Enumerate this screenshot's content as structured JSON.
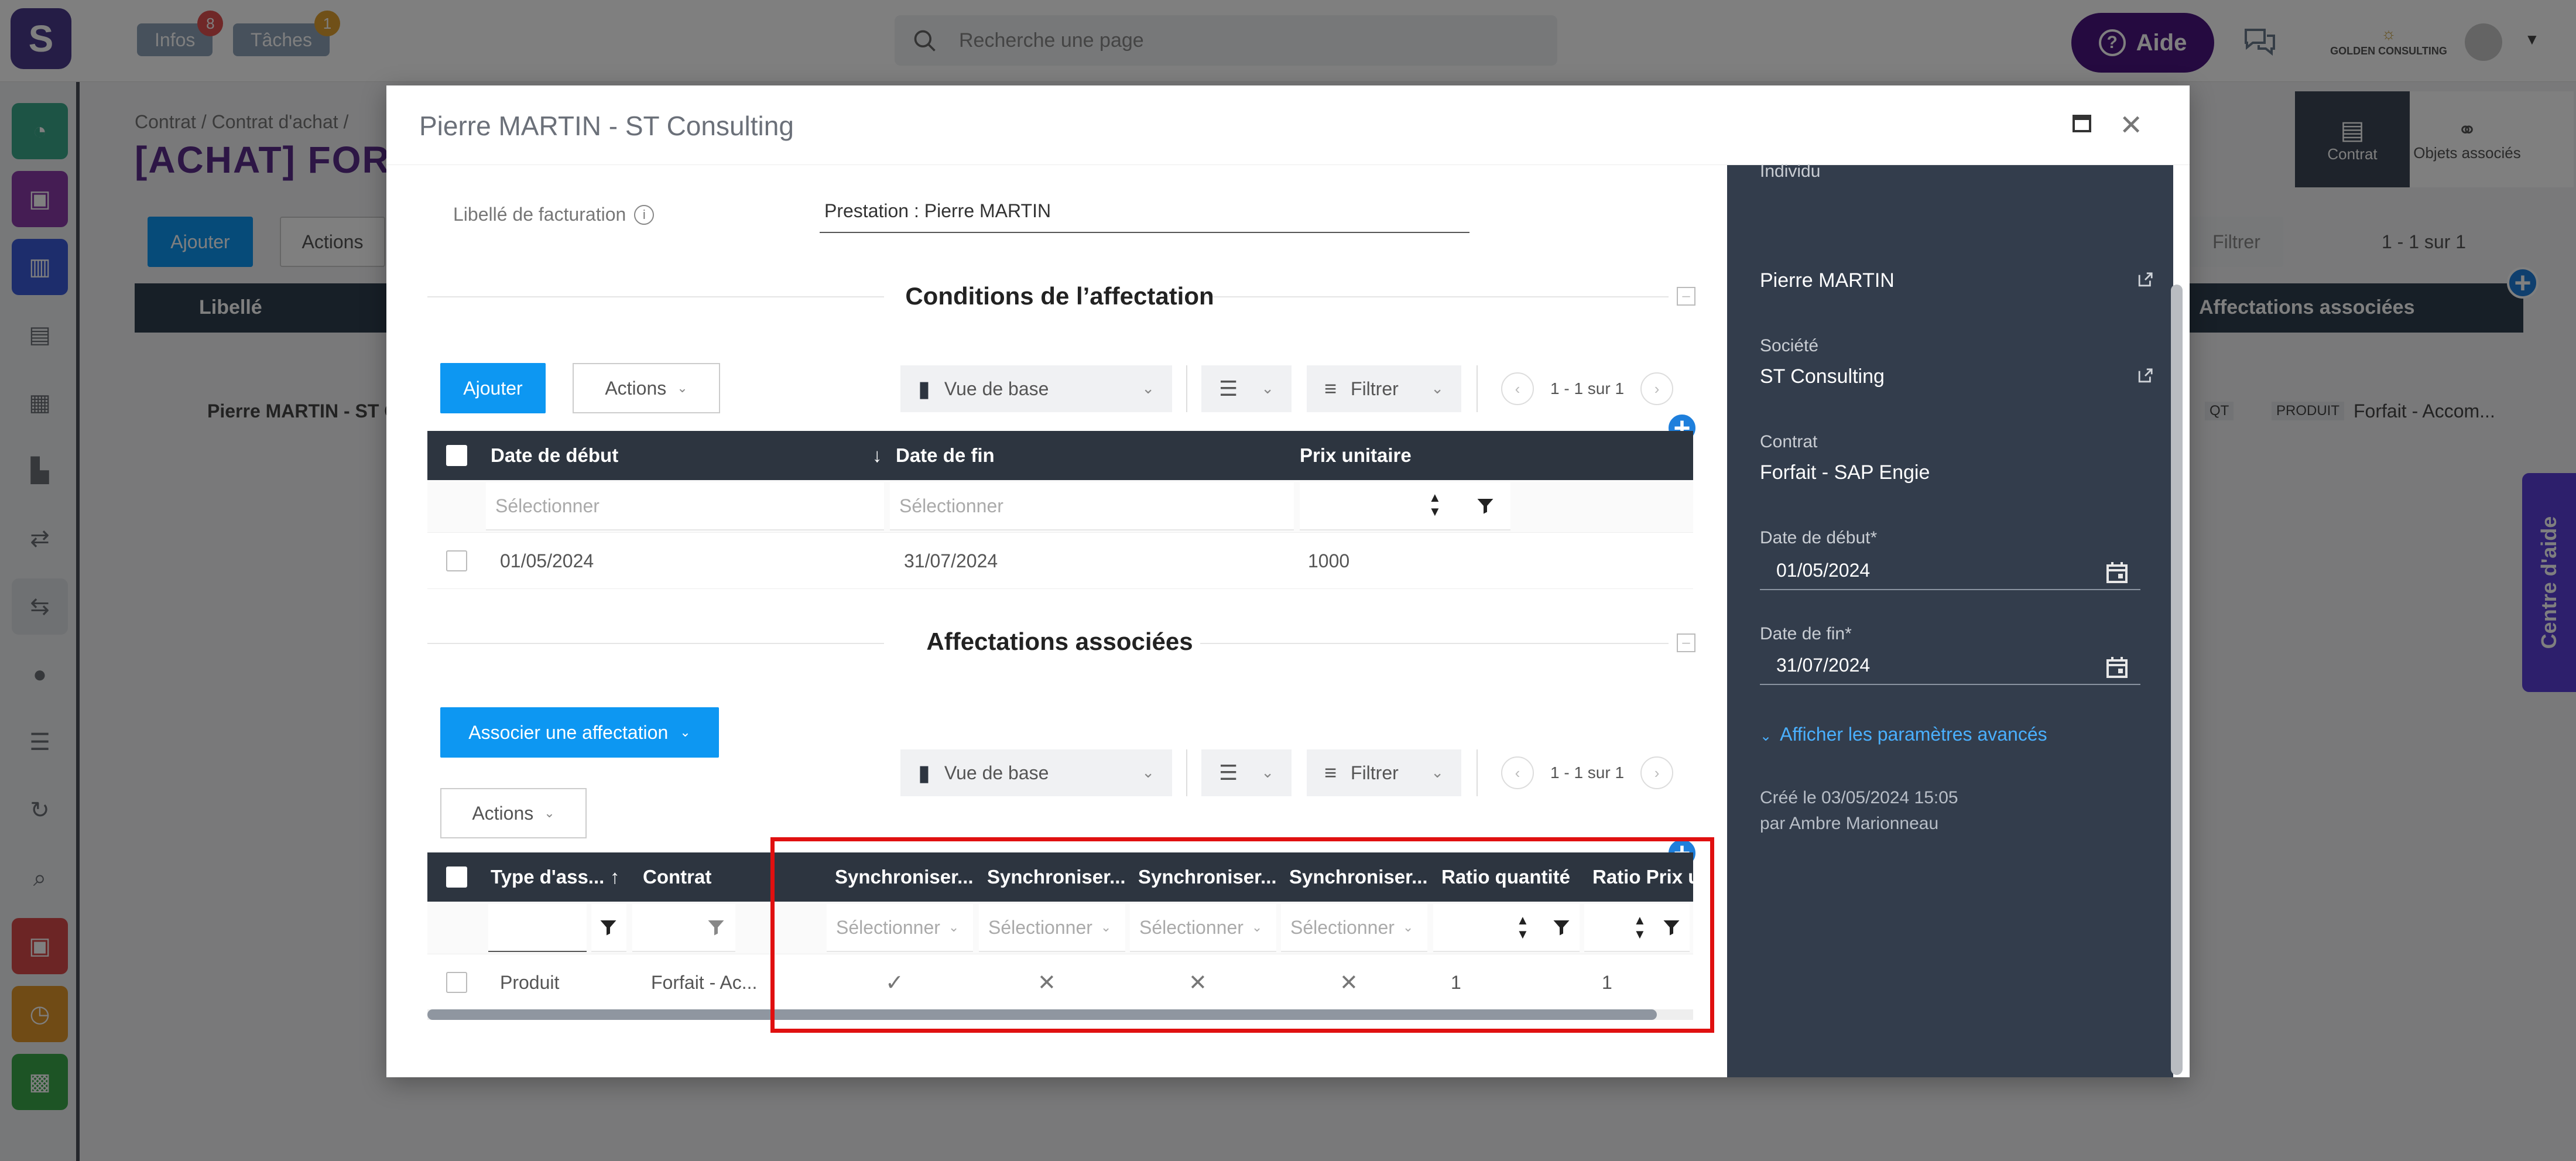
{
  "topbar": {
    "logo": "S",
    "infos_label": "Infos",
    "infos_count": "8",
    "taches_label": "Tâches",
    "taches_count": "1",
    "search_placeholder": "Recherche une page",
    "aide_label": "Aide",
    "company": "GOLDEN CONSULTING"
  },
  "background": {
    "breadcrumb": "Contrat  /  Contrat d'achat  /",
    "title": "[ACHAT] FOR",
    "ajouter": "Ajouter",
    "actions": "Actions",
    "filtrer": "Filtrer",
    "pager": "1 - 1 sur 1",
    "col_libelle": "Libellé",
    "col_affectations": "Affectations associées",
    "row_libelle": "Pierre MARTIN - ST C",
    "row_tag1": "QT",
    "row_tag2": "PRODUIT",
    "row_right": "Forfait - Accom...",
    "tab_contrat": "Contrat",
    "tab_objets": "Objets associés",
    "centre_aide": "Centre d'aide"
  },
  "modal": {
    "title": "Pierre MARTIN - ST Consulting",
    "libelle_label": "Libellé de facturation",
    "libelle_value": "Prestation : Pierre MARTIN",
    "conditions": {
      "section_title": "Conditions de l’affectation",
      "ajouter": "Ajouter",
      "actions": "Actions",
      "vue": "Vue de base",
      "filtrer": "Filtrer",
      "pager": "1 - 1 sur 1",
      "columns": [
        "Date de début",
        "Date de fin",
        "Prix unitaire"
      ],
      "filter_placeholder": "Sélectionner",
      "row": [
        "01/05/2024",
        "31/07/2024",
        "1000"
      ]
    },
    "affectations": {
      "section_title": "Affectations associées",
      "associer": "Associer une affectation",
      "actions": "Actions",
      "vue": "Vue de base",
      "filtrer": "Filtrer",
      "pager": "1 - 1 sur 1",
      "columns": [
        "Type d'ass...",
        "Contrat",
        "Synchroniser...",
        "Synchroniser...",
        "Synchroniser...",
        "Synchroniser...",
        "Ratio quantité",
        "Ratio Prix un..."
      ],
      "filter_placeholder": "Sélectionner",
      "row": {
        "type": "Produit",
        "contrat": "Forfait - Ac...",
        "sync1": "✓",
        "sync2": "✕",
        "sync3": "✕",
        "sync4": "✕",
        "ratio_qte": "1",
        "ratio_prix": "1"
      }
    },
    "panel": {
      "individu_label": "Individu",
      "individu_value": "Pierre MARTIN",
      "societe_label": "Société",
      "societe_value": "ST Consulting",
      "contrat_label": "Contrat",
      "contrat_value": "Forfait - SAP Engie",
      "date_debut_label": "Date de début*",
      "date_debut_value": "01/05/2024",
      "date_fin_label": "Date de fin*",
      "date_fin_value": "31/07/2024",
      "advanced_link": "Afficher les paramètres avancés",
      "created_line": "Créé le   03/05/2024 15:05",
      "created_by": "par Ambre Marionneau"
    }
  },
  "colors": {
    "accent_blue": "#0d97f2",
    "aide_purple": "#4a1580",
    "panel_dark": "#333d4c",
    "highlight_red": "#e01010"
  }
}
